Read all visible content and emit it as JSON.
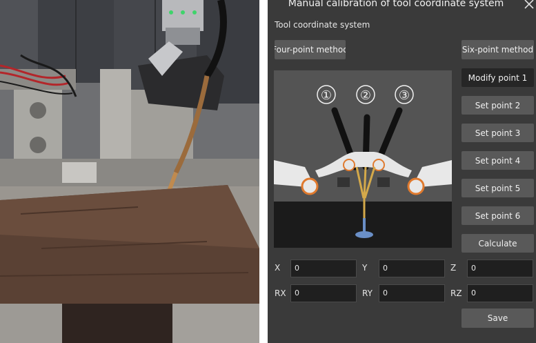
{
  "dialog": {
    "title": "Manual calibration of tool coordinate system",
    "section_label": "Tool coordinate system"
  },
  "methods": {
    "four_point": "Four-point method",
    "six_point": "Six-point method"
  },
  "point_buttons": [
    "Modify point 1",
    "Set point 2",
    "Set point 3",
    "Set point 4",
    "Set point 5",
    "Set point 6"
  ],
  "calculate_label": "Calculate",
  "illustration": {
    "markers": [
      "①",
      "②",
      "③"
    ]
  },
  "fields": {
    "x": {
      "label": "X",
      "value": "0"
    },
    "y": {
      "label": "Y",
      "value": "0"
    },
    "z": {
      "label": "Z",
      "value": "0"
    },
    "rx": {
      "label": "RX",
      "value": "0"
    },
    "ry": {
      "label": "RY",
      "value": "0"
    },
    "rz": {
      "label": "RZ",
      "value": "0"
    }
  },
  "save_label": "Save"
}
